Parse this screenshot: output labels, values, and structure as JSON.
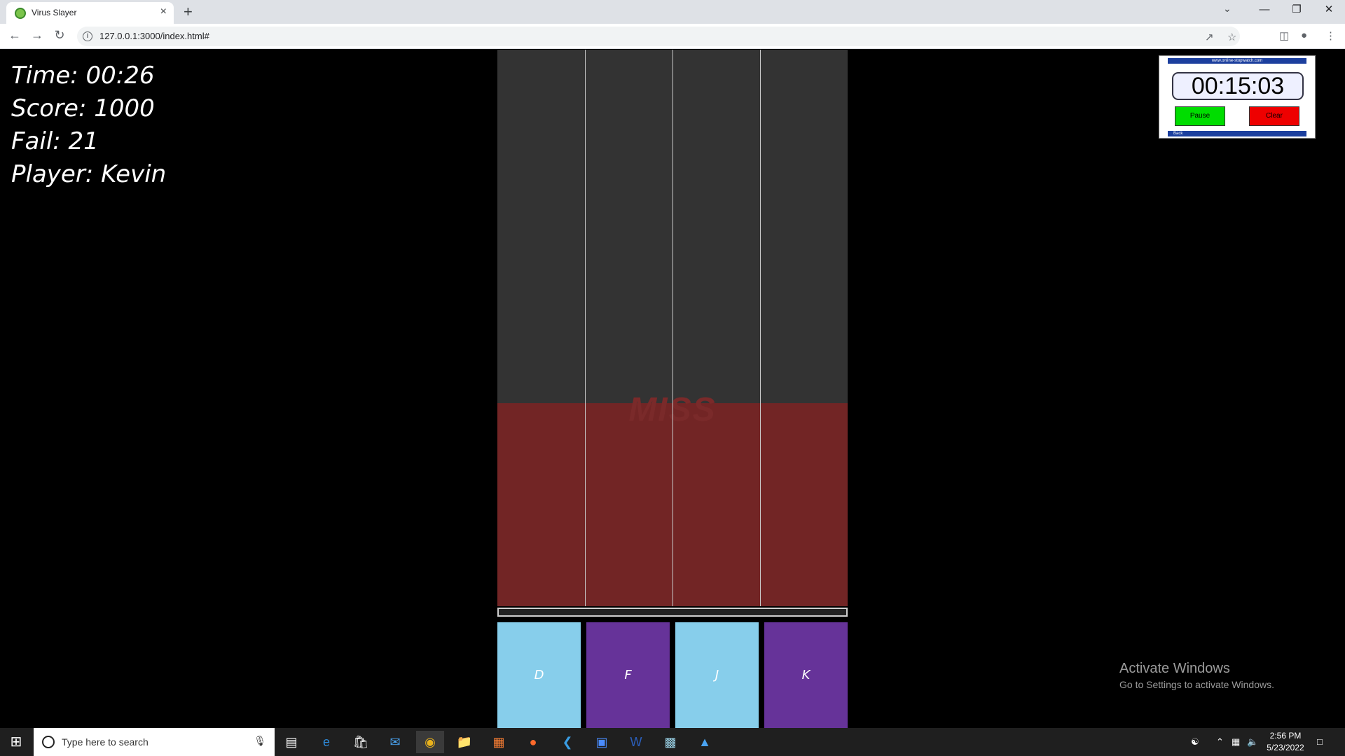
{
  "browser": {
    "tab_title": "Virus Slayer",
    "tab_close": "×",
    "new_tab": "+",
    "url": "127.0.0.1:3000/index.html#",
    "info_glyph": "i"
  },
  "hud": {
    "time": "Time: 00:26",
    "score": "Score: 1000",
    "fail": "Fail: 21",
    "player": "Player: Kevin"
  },
  "game": {
    "miss_text": "MISS",
    "lanes": [
      {
        "key": "D",
        "color": "#87ceeb"
      },
      {
        "key": "F",
        "color": "#663399"
      },
      {
        "key": "J",
        "color": "#87ceeb"
      },
      {
        "key": "K",
        "color": "#663399"
      }
    ],
    "track_color": "#333333",
    "miss_zone_color": "#722525"
  },
  "stopwatch": {
    "site": "www.online-stopwatch.com",
    "time": "00:15:03",
    "pause_label": "Pause",
    "clear_label": "Clear",
    "back_label": "Back",
    "pause_color": "#00dd00",
    "clear_color": "#ee0000"
  },
  "watermark": {
    "title": "Activate Windows",
    "subtitle": "Go to Settings to activate Windows."
  },
  "taskbar": {
    "search_placeholder": "Type here to search",
    "time": "2:56 PM",
    "date": "5/23/2022"
  }
}
